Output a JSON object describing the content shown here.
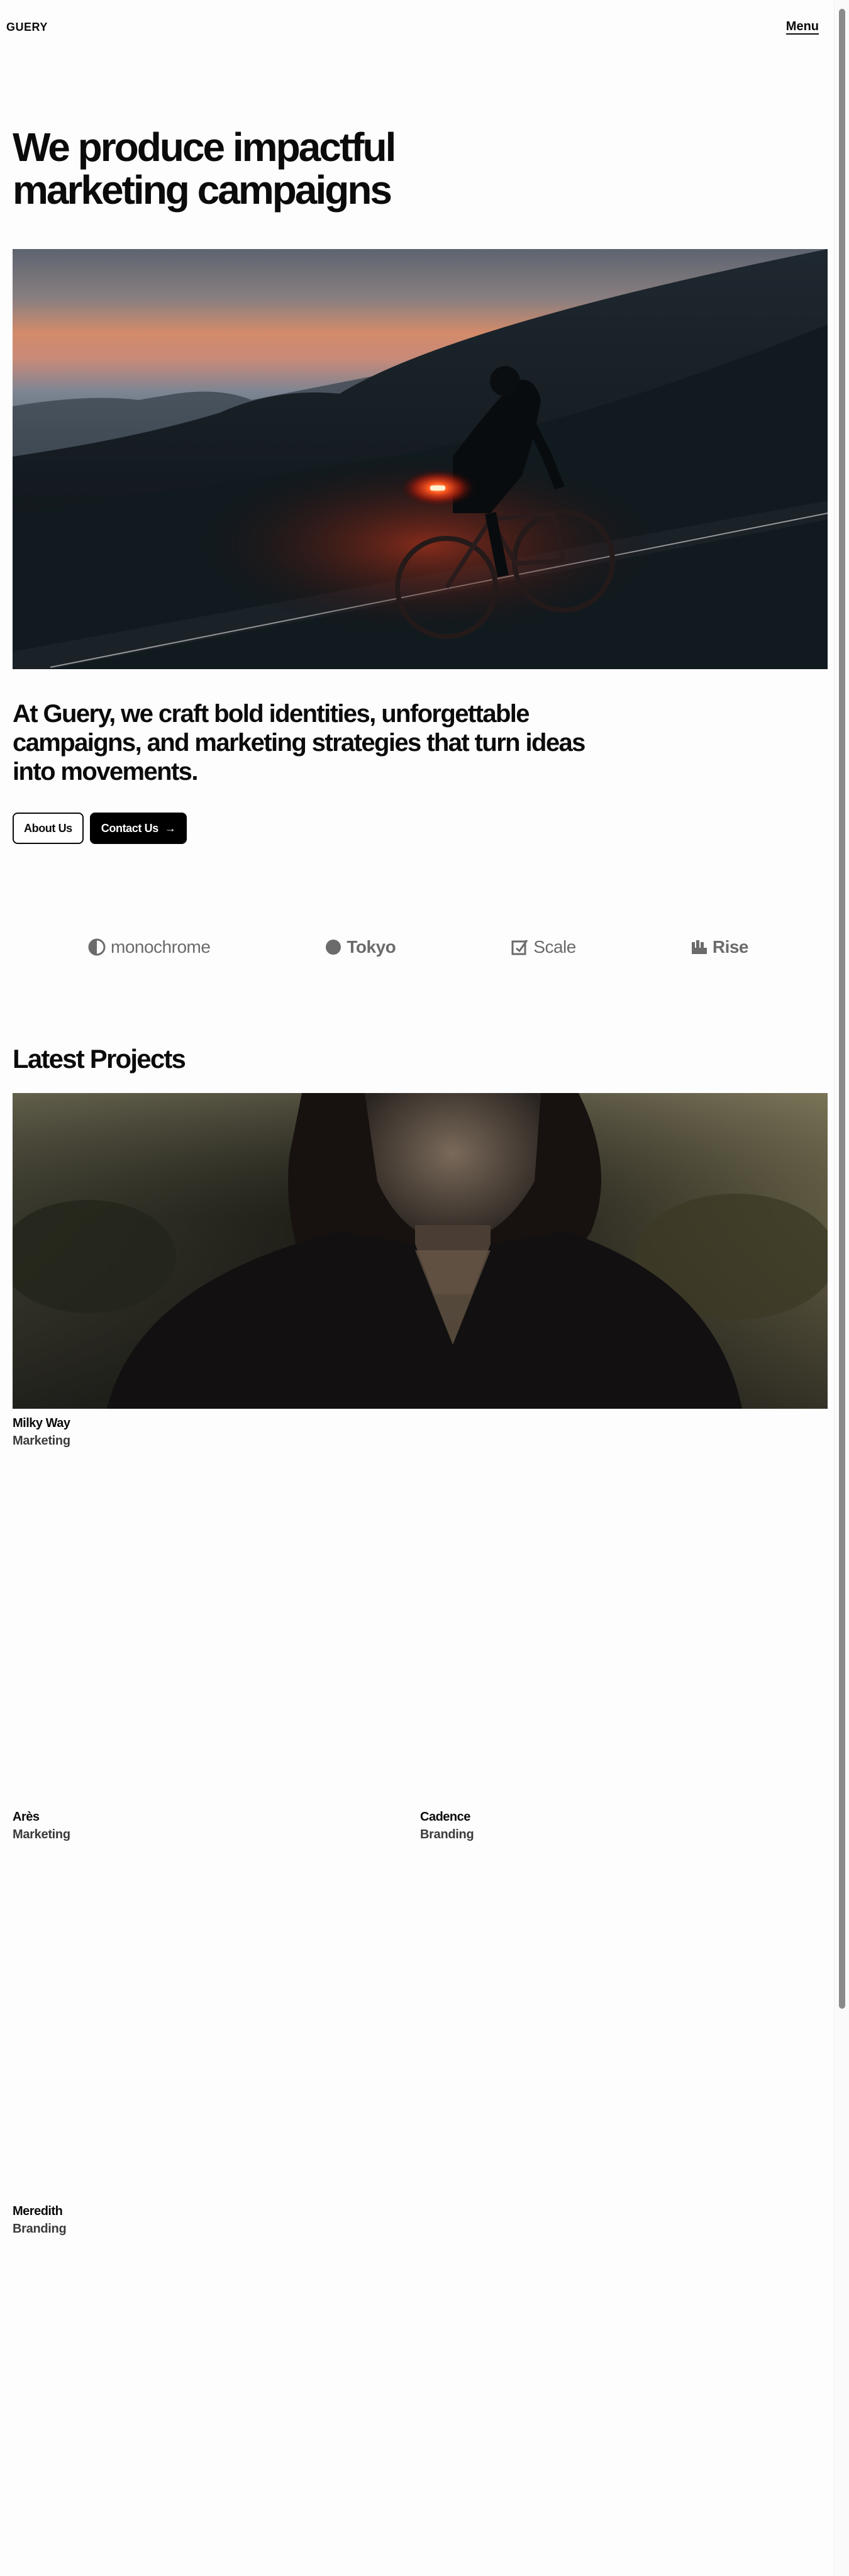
{
  "header": {
    "logo": "GUERY",
    "menu_label": "Menu"
  },
  "hero": {
    "title": "We produce impactful marketing campaigns"
  },
  "intro": {
    "text": "At Guery, we craft bold identities, unforgettable campaigns, and marketing strategies that turn ideas into movements.",
    "about_label": "About Us",
    "contact_label": "Contact Us"
  },
  "clients": [
    {
      "name": "monochrome",
      "icon": "half-circle-icon"
    },
    {
      "name": "Tokyo",
      "icon": "circle-icon"
    },
    {
      "name": "Scale",
      "icon": "checkbox-icon"
    },
    {
      "name": "Rise",
      "icon": "bars-icon"
    }
  ],
  "projects": {
    "title": "Latest Projects",
    "items": [
      {
        "name": "Milky Way",
        "category": "Marketing"
      },
      {
        "name": "Arès",
        "category": "Marketing"
      },
      {
        "name": "Cadence",
        "category": "Branding"
      },
      {
        "name": "Meredith",
        "category": "Branding"
      }
    ]
  },
  "colors": {
    "text": "#0b0b0b",
    "button": "#000000",
    "background": "#fdfdfd",
    "logo_gray": "#6b6b6b"
  }
}
